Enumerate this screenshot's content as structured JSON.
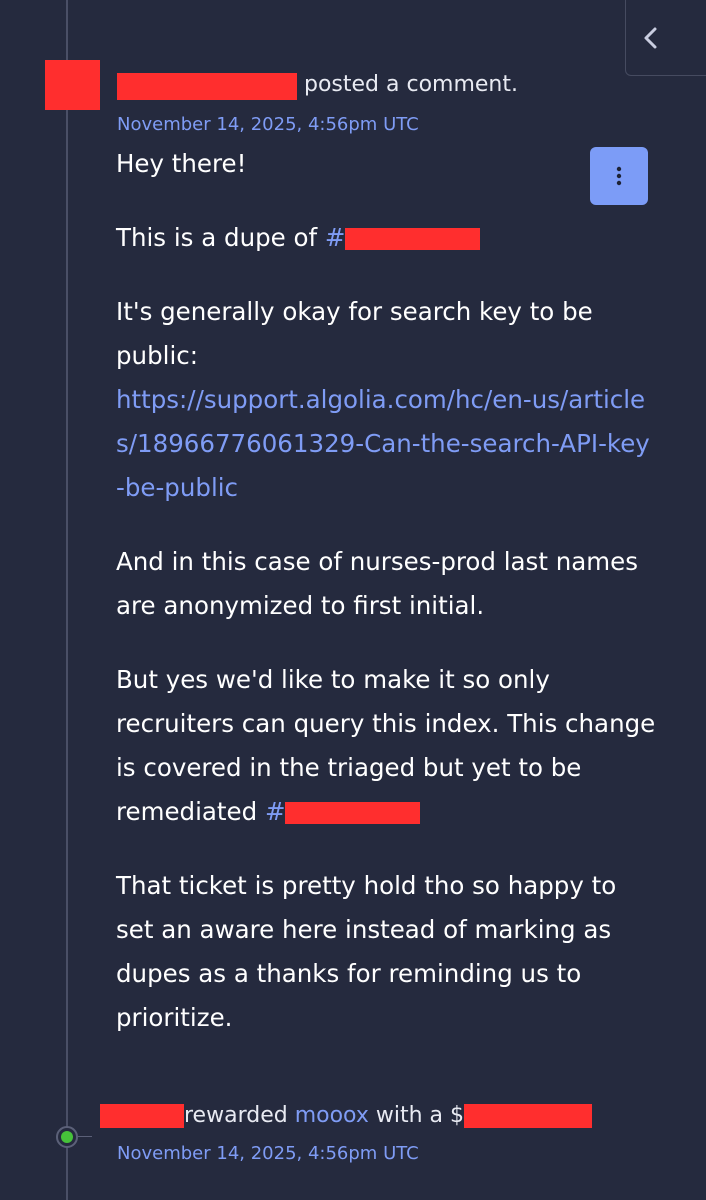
{
  "header": {
    "action_text": "posted a comment.",
    "timestamp": "November 14, 2025, 4:56pm UTC"
  },
  "comment": {
    "greeting": "Hey there!",
    "dupe_prefix": "This is a dupe of ",
    "hash_symbol": "#",
    "search_key_text": "It's generally okay for search key to be public:",
    "link_text": "https://support.algolia.com/hc/en-us/articles/18966776061329-Can-the-search-API-key-be-public",
    "nurses_text": "And in this case of nurses-prod last names are anonymized to first initial.",
    "recruiters_text": "But yes we'd like to make it so only recruiters can query this index. This change is covered in the triaged but yet to be remediated ",
    "ticket_text": "That ticket is pretty hold tho so happy to set an aware here instead of marking as dupes as a thanks for reminding us to prioritize."
  },
  "reward": {
    "action_text": "rewarded",
    "recipient": "mooox",
    "with_text": "with a $",
    "timestamp": "November 14, 2025, 4:56pm UTC"
  },
  "icons": {
    "collapse": "chevron-left-icon",
    "menu": "vertical-dots-icon",
    "timeline_marker": "green-dot-icon"
  },
  "colors": {
    "background": "#252a3e",
    "accent": "#7f9cf5",
    "redaction": "#ff2e2e",
    "menu_button": "#7c9cf7",
    "marker": "#46c23a"
  }
}
